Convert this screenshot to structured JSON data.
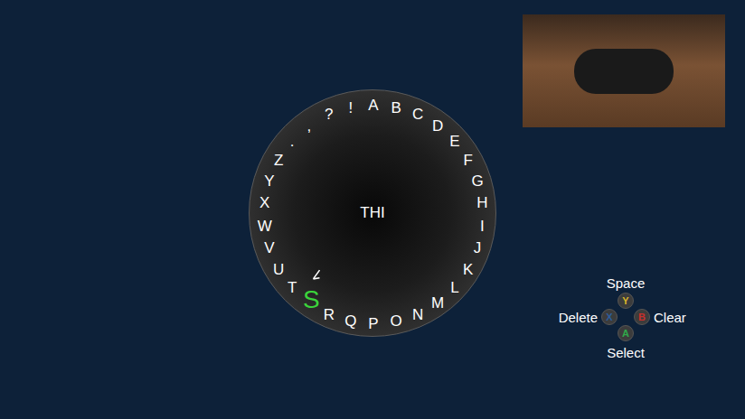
{
  "dial": {
    "text": "THI",
    "characters": [
      {
        "label": "A",
        "selected": false
      },
      {
        "label": "B",
        "selected": false
      },
      {
        "label": "C",
        "selected": false
      },
      {
        "label": "D",
        "selected": false
      },
      {
        "label": "E",
        "selected": false
      },
      {
        "label": "F",
        "selected": false
      },
      {
        "label": "G",
        "selected": false
      },
      {
        "label": "H",
        "selected": false
      },
      {
        "label": "I",
        "selected": false
      },
      {
        "label": "J",
        "selected": false
      },
      {
        "label": "K",
        "selected": false
      },
      {
        "label": "L",
        "selected": false
      },
      {
        "label": "M",
        "selected": false
      },
      {
        "label": "N",
        "selected": false
      },
      {
        "label": "O",
        "selected": false
      },
      {
        "label": "P",
        "selected": false
      },
      {
        "label": "Q",
        "selected": false
      },
      {
        "label": "R",
        "selected": false
      },
      {
        "label": "S",
        "selected": true
      },
      {
        "label": "T",
        "selected": false
      },
      {
        "label": "U",
        "selected": false
      },
      {
        "label": "V",
        "selected": false
      },
      {
        "label": "W",
        "selected": false
      },
      {
        "label": "X",
        "selected": false
      },
      {
        "label": "Y",
        "selected": false
      },
      {
        "label": "Z",
        "selected": false
      },
      {
        "label": ".",
        "selected": false
      },
      {
        "label": ",",
        "selected": false
      },
      {
        "label": "?",
        "selected": false
      },
      {
        "label": "!",
        "selected": false
      }
    ]
  },
  "controls": [
    {
      "action": "Space",
      "key": "Y",
      "color": "#d9b52a"
    },
    {
      "action": "Delete",
      "key": "X",
      "color": "#2d5f9e"
    },
    {
      "action": "Clear",
      "key": "B",
      "color": "#c8302c"
    },
    {
      "action": "Select",
      "key": "A",
      "color": "#2fa84a"
    }
  ]
}
